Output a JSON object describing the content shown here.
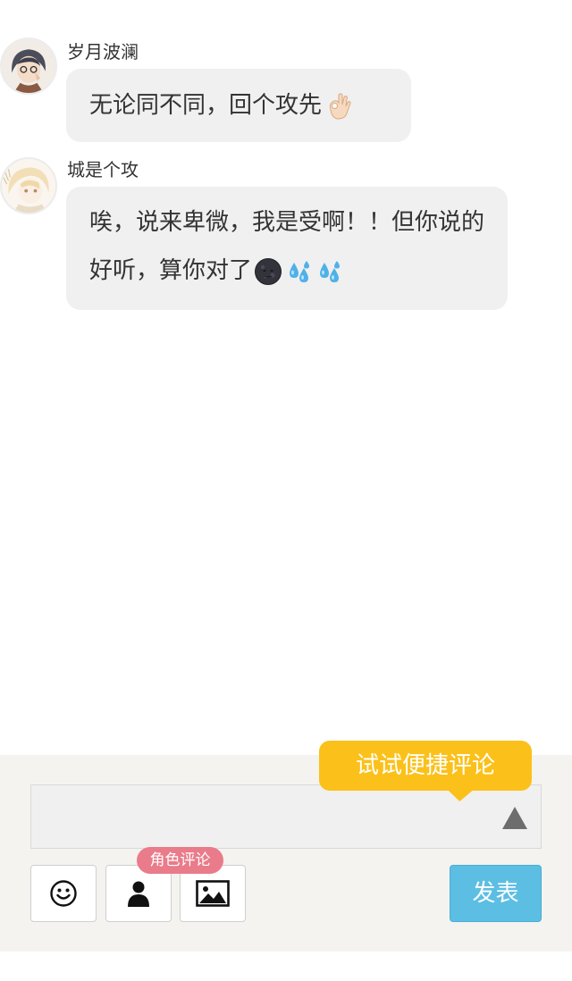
{
  "messages": [
    {
      "author": "岁月波澜",
      "text": "无论同不同，回个攻先",
      "emoji": [
        "ok-hand-emoji"
      ]
    },
    {
      "author": "城是个攻",
      "text": "唉，说来卑微，我是受啊！！但你说的好听，算你对了",
      "emoji": [
        "new-moon-face-emoji",
        "sweat-droplets-emoji",
        "sweat-droplets-emoji"
      ]
    }
  ],
  "composer": {
    "hint": "试试便捷评论",
    "role_badge": "角色评论",
    "submit_label": "发表",
    "icons": [
      "smiley-icon",
      "person-icon",
      "image-icon",
      "triangle-up-icon"
    ]
  },
  "colors": {
    "bubble_bg": "#f0f0f0",
    "composer_bg": "#f4f3ef",
    "hint_bg": "#fbc11a",
    "badge_bg": "#ea7b8a",
    "submit_bg": "#5cbee2"
  }
}
